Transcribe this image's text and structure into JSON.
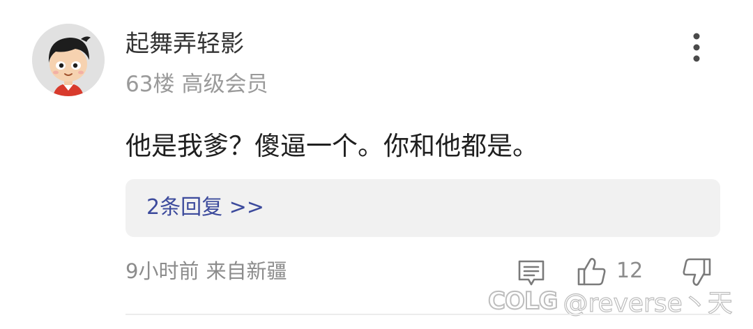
{
  "comment": {
    "username": "起舞弄轻影",
    "floor": "63楼",
    "member_level": "高级会员",
    "content": "他是我爹？傻逼一个。你和他都是。",
    "replies_link": "2条回复 >>",
    "time": "9小时前",
    "location": "来自新疆",
    "like_count": "12"
  },
  "icons": {
    "more": "more-vertical-icon",
    "comment": "comment-icon",
    "like": "thumbs-up-icon",
    "dislike": "thumbs-down-icon"
  },
  "watermark": {
    "logo": "COLG",
    "text": "@reverse丶天"
  },
  "colors": {
    "reply_link": "#3c4a9c",
    "reply_box_bg": "#f1f1f1",
    "meta_text": "#9a9a9a"
  }
}
